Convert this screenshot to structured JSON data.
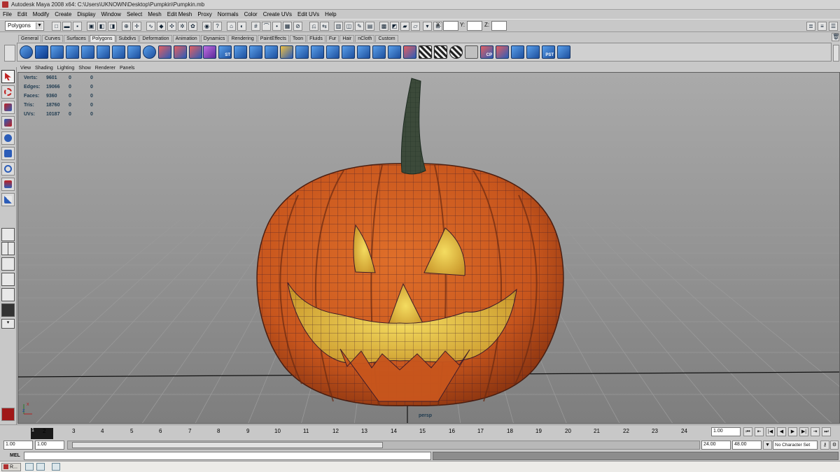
{
  "window": {
    "title": "Autodesk Maya 2008 x64: C:\\Users\\UKNOWN\\Desktop\\Pumpkin\\Pumpkin.mb"
  },
  "menubar": {
    "items": [
      "File",
      "Edit",
      "Modify",
      "Create",
      "Display",
      "Window",
      "Select",
      "Mesh",
      "Edit Mesh",
      "Proxy",
      "Normals",
      "Color",
      "Create UVs",
      "Edit UVs",
      "Help"
    ]
  },
  "status_line": {
    "mode": "Polygons",
    "x_label": "X:",
    "y_label": "Y:",
    "z_label": "Z:"
  },
  "shelf": {
    "tabs": [
      "General",
      "Curves",
      "Surfaces",
      "Polygons",
      "Subdivs",
      "Deformation",
      "Animation",
      "Dynamics",
      "Rendering",
      "PaintEffects",
      "Toon",
      "Fluids",
      "Fur",
      "Hair",
      "nCloth",
      "Custom"
    ],
    "active_tab": "Polygons",
    "icon_labels": [
      "ST",
      "CP",
      "PST"
    ]
  },
  "panel_menu": {
    "items": [
      "View",
      "Shading",
      "Lighting",
      "Show",
      "Renderer",
      "Panels"
    ]
  },
  "hud": {
    "rows": [
      {
        "label": "Verts:",
        "value": "9601",
        "a": "0",
        "b": "0"
      },
      {
        "label": "Edges:",
        "value": "19066",
        "a": "0",
        "b": "0"
      },
      {
        "label": "Faces:",
        "value": "9360",
        "a": "0",
        "b": "0"
      },
      {
        "label": "Tris:",
        "value": "18760",
        "a": "0",
        "b": "0"
      },
      {
        "label": "UVs:",
        "value": "10187",
        "a": "0",
        "b": "0"
      }
    ],
    "camera": "persp",
    "axis_x": "x",
    "axis_z": "z"
  },
  "colors": {
    "pumpkin": "#c8561d",
    "stem": "#3c4a3a",
    "glow": "#e8c63a",
    "wire": "#3b1a2a",
    "viewport_top": "#aaaaaa",
    "viewport_bottom": "#7e7e7e"
  },
  "time_slider": {
    "ticks": [
      "2",
      "3",
      "4",
      "5",
      "6",
      "7",
      "8",
      "9",
      "10",
      "11",
      "12",
      "13",
      "14",
      "15",
      "16",
      "17",
      "18",
      "19",
      "20",
      "21",
      "22",
      "23",
      "24"
    ],
    "current_frame": "1",
    "current_time_field": "1.00"
  },
  "range": {
    "start_time": "1.00",
    "playback_start": "1.00",
    "playback_end": "24.00",
    "end_time": "48.00",
    "character_set": "No Character Set"
  },
  "command_line": {
    "label": "MEL"
  },
  "taskbar": {
    "task_label": "R..."
  }
}
